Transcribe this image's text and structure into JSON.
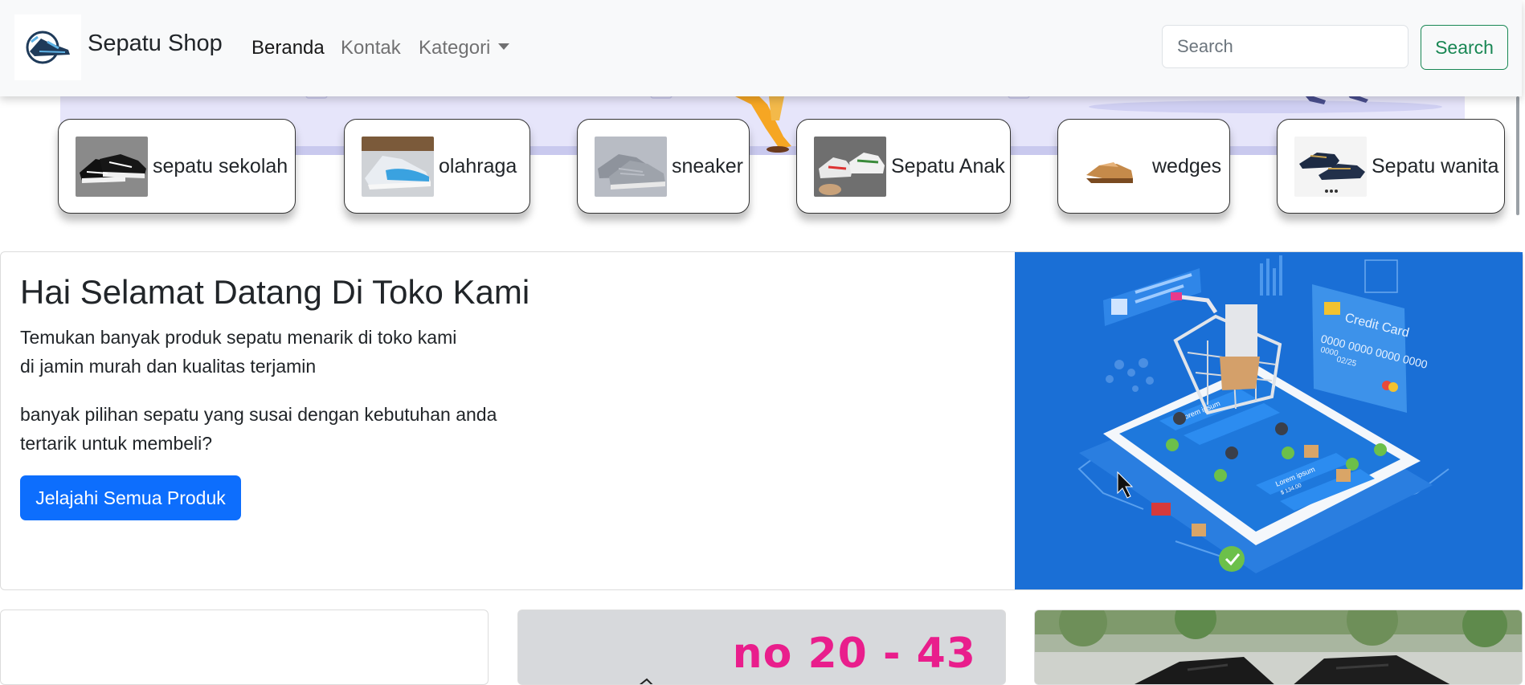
{
  "navbar": {
    "brand": "Sepatu Shop",
    "links": [
      {
        "label": "Beranda"
      },
      {
        "label": "Kontak"
      },
      {
        "label": "Kategori"
      }
    ],
    "search_placeholder": "Search",
    "search_button": "Search"
  },
  "categories": [
    {
      "label": "sepatu sekolah"
    },
    {
      "label": "olahraga"
    },
    {
      "label": "sneaker"
    },
    {
      "label": "Sepatu Anak"
    },
    {
      "label": "wedges"
    },
    {
      "label": "Sepatu wanita"
    }
  ],
  "hero": {
    "title": "Hai Selamat Datang Di Toko Kami",
    "line1": "Temukan banyak produk sepatu menarik di toko kami",
    "line2": "di jamin murah dan kualitas terjamin",
    "line3": "banyak pilihan sepatu yang susai dengan kebutuhan anda",
    "line4": "tertarik untuk membeli?",
    "button": "Jelajahi Semua Produk",
    "image_texts": {
      "card_title": "Credit Card",
      "card_number": "0000 0000 0000 0000",
      "card_exp": "02/25",
      "card_small": "0000",
      "lorem": "Lorem ipsum",
      "price": "$ 134.00"
    }
  },
  "products": {
    "sizes_text": "no 20 - 43"
  },
  "colors": {
    "primary": "#0d6efd",
    "success": "#198754",
    "navbar_bg": "#f8f9fa",
    "hero_image_bg": "#1a6fd6"
  }
}
